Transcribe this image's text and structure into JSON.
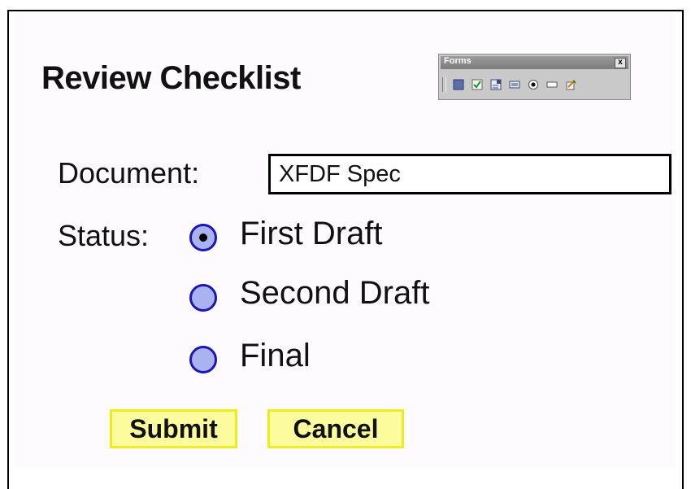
{
  "title": "Review Checklist",
  "toolbar": {
    "title": "Forms",
    "close_label": "x",
    "buttons": [
      "button-tool",
      "checkbox-tool",
      "combobox-tool",
      "listbox-tool",
      "radio-tool",
      "textfield-tool",
      "signature-tool"
    ]
  },
  "document": {
    "label": "Document:",
    "value": "XFDF Spec"
  },
  "status": {
    "label": "Status:",
    "options": [
      {
        "label": "First Draft",
        "selected": true
      },
      {
        "label": "Second Draft",
        "selected": false
      },
      {
        "label": "Final",
        "selected": false
      }
    ]
  },
  "actions": {
    "submit_label": "Submit",
    "cancel_label": "Cancel"
  },
  "colors": {
    "radio_border": "#1d15b5",
    "radio_fill": "#a9b3f0",
    "button_fill": "#fcfb9e",
    "button_border": "#eded1c"
  }
}
